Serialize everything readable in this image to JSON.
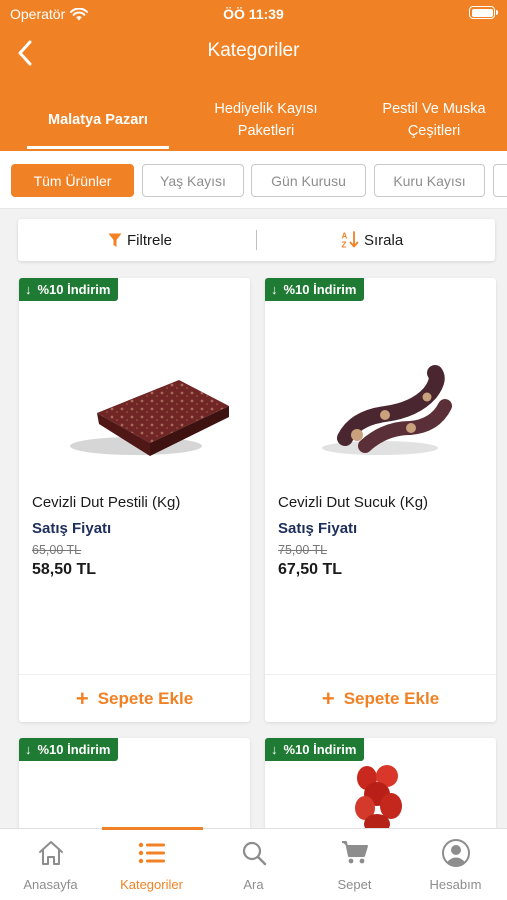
{
  "status_bar": {
    "carrier": "Operatör",
    "time": "ÖÖ 11:39"
  },
  "nav": {
    "title": "Kategoriler",
    "back_icon": "chevron-left-icon"
  },
  "category_tabs": [
    {
      "label": "Malatya Pazarı",
      "active": true
    },
    {
      "label": "Hediyelik Kayısı Paketleri",
      "active": false
    },
    {
      "label": "Pestil Ve Muska Çeşitleri",
      "active": false
    }
  ],
  "subcategories": [
    {
      "label": "Tüm Ürünler",
      "active": true
    },
    {
      "label": "Yaş Kayısı",
      "active": false
    },
    {
      "label": "Gün Kurusu",
      "active": false
    },
    {
      "label": "Kuru Kayısı",
      "active": false
    }
  ],
  "toolbar": {
    "filter_label": "Filtrele",
    "sort_label": "Sırala",
    "filter_icon": "funnel-icon",
    "sort_icon": "sort-az-icon"
  },
  "products": [
    {
      "badge": "%10 İndirim",
      "name": "Cevizli Dut Pestili (Kg)",
      "price_label": "Satış Fiyatı",
      "old_price": "65,00 TL",
      "price": "58,50 TL",
      "add_label": "Sepete Ekle"
    },
    {
      "badge": "%10 İndirim",
      "name": "Cevizli Dut Sucuk (Kg)",
      "price_label": "Satış Fiyatı",
      "old_price": "75,00 TL",
      "price": "67,50 TL",
      "add_label": "Sepete Ekle"
    },
    {
      "badge": "%10 İndirim"
    },
    {
      "badge": "%10 İndirim"
    }
  ],
  "tabbar": [
    {
      "label": "Anasayfa",
      "icon": "home-icon",
      "active": false
    },
    {
      "label": "Kategoriler",
      "icon": "list-icon",
      "active": true
    },
    {
      "label": "Ara",
      "icon": "search-icon",
      "active": false
    },
    {
      "label": "Sepet",
      "icon": "cart-icon",
      "active": false
    },
    {
      "label": "Hesabım",
      "icon": "account-icon",
      "active": false
    }
  ],
  "colors": {
    "brand": "#f08225",
    "badge": "#1f7a33",
    "price_label": "#1e2f5a"
  }
}
